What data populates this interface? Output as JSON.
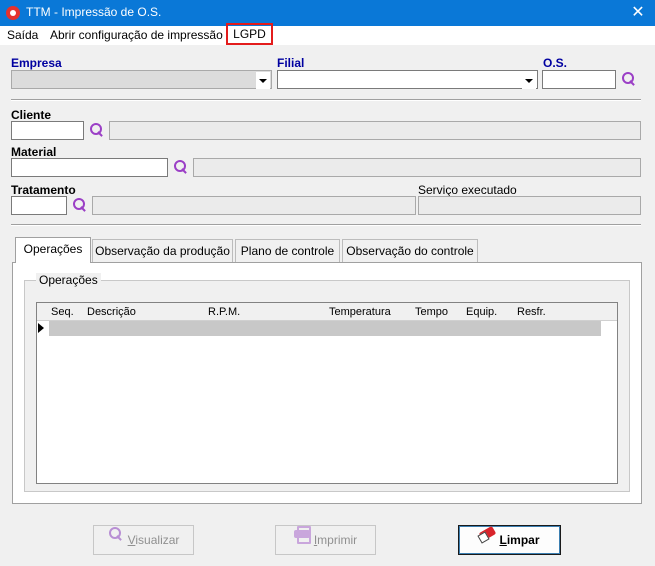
{
  "window": {
    "title": "TTM - Impressão de O.S.",
    "close_glyph": "✕"
  },
  "menu": {
    "saida": "Saída",
    "abrir": "Abrir configuração de impressão",
    "lgpd": "LGPD"
  },
  "form": {
    "empresa_label": "Empresa",
    "filial_label": "Filial",
    "os_label": "O.S.",
    "cliente_label": "Cliente",
    "material_label": "Material",
    "tratamento_label": "Tratamento",
    "servico_label": "Serviço executado",
    "empresa_value": "",
    "filial_value": "",
    "os_value": "",
    "cliente_value": "",
    "material_value": "",
    "tratamento_value": ""
  },
  "tabs": [
    {
      "label": "Operações"
    },
    {
      "label": "Observação da produção"
    },
    {
      "label": "Plano de controle"
    },
    {
      "label": "Observação do controle"
    }
  ],
  "group_title": "Operações",
  "grid": {
    "columns": [
      "Seq.",
      "Descrição",
      "R.P.M.",
      "Temperatura",
      "Tempo",
      "Equip.",
      "Resfr."
    ]
  },
  "buttons": {
    "visualizar": {
      "accel": "V",
      "rest": "isualizar"
    },
    "imprimir": {
      "accel": "I",
      "rest": "mprimir"
    },
    "limpar": {
      "accel": "L",
      "rest": "impar"
    }
  },
  "icons": {
    "search": "magnifier-icon",
    "printer": "printer-icon",
    "eraser": "eraser-icon"
  },
  "colors": {
    "titlebar": "#0a78d7",
    "label_blue": "#0000a0",
    "highlight_box": "#e31c1c",
    "search_icon": "#9b3fc6"
  }
}
